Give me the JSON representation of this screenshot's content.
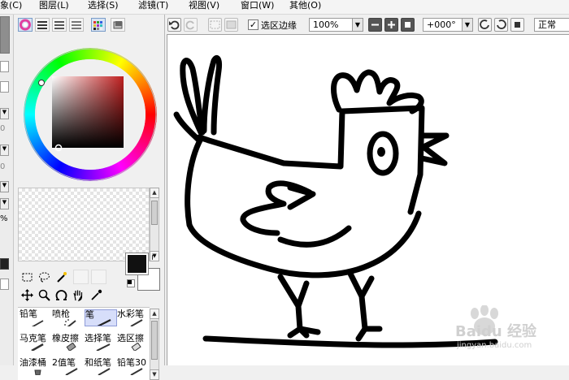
{
  "menubar": {
    "items": [
      "象(C)",
      "图层(L)",
      "选择(S)",
      "滤镜(T)",
      "视图(V)",
      "窗口(W)",
      "其他(O)"
    ]
  },
  "toolbar": {
    "selection_edge_label": "选区边缘",
    "selection_edge_checked": true,
    "zoom_value": "100%",
    "rotation_value": "+000°",
    "blend_mode": "正常"
  },
  "left_strip": {
    "value_a": "0",
    "value_b": "0",
    "value_c": "%"
  },
  "color": {
    "foreground": "#111111",
    "background": "#ffffff",
    "hue_color": "#c02020"
  },
  "brush_tools": [
    {
      "label": "铅笔",
      "icon": "pencil-icon",
      "selected": false
    },
    {
      "label": "喷枪",
      "icon": "airbrush-icon",
      "selected": false
    },
    {
      "label": "笔",
      "icon": "pen-icon",
      "selected": true
    },
    {
      "label": "水彩笔",
      "icon": "watercolor-brush-icon",
      "selected": false
    },
    {
      "label": "马克笔",
      "icon": "marker-icon",
      "selected": false
    },
    {
      "label": "橡皮擦",
      "icon": "eraser-icon",
      "selected": false
    },
    {
      "label": "选择笔",
      "icon": "select-pen-icon",
      "selected": false
    },
    {
      "label": "选区擦",
      "icon": "select-eraser-icon",
      "selected": false
    },
    {
      "label": "油漆桶",
      "icon": "paint-bucket-icon",
      "selected": false
    },
    {
      "label": "2值笔",
      "icon": "binary-pen-icon",
      "selected": false
    },
    {
      "label": "和纸笔",
      "icon": "washi-pen-icon",
      "selected": false
    },
    {
      "label": "铅笔30",
      "icon": "pencil30-icon",
      "selected": false
    }
  ],
  "watermark": {
    "brand": "Baidu 经验",
    "url": "jingyan.baidu.com"
  }
}
